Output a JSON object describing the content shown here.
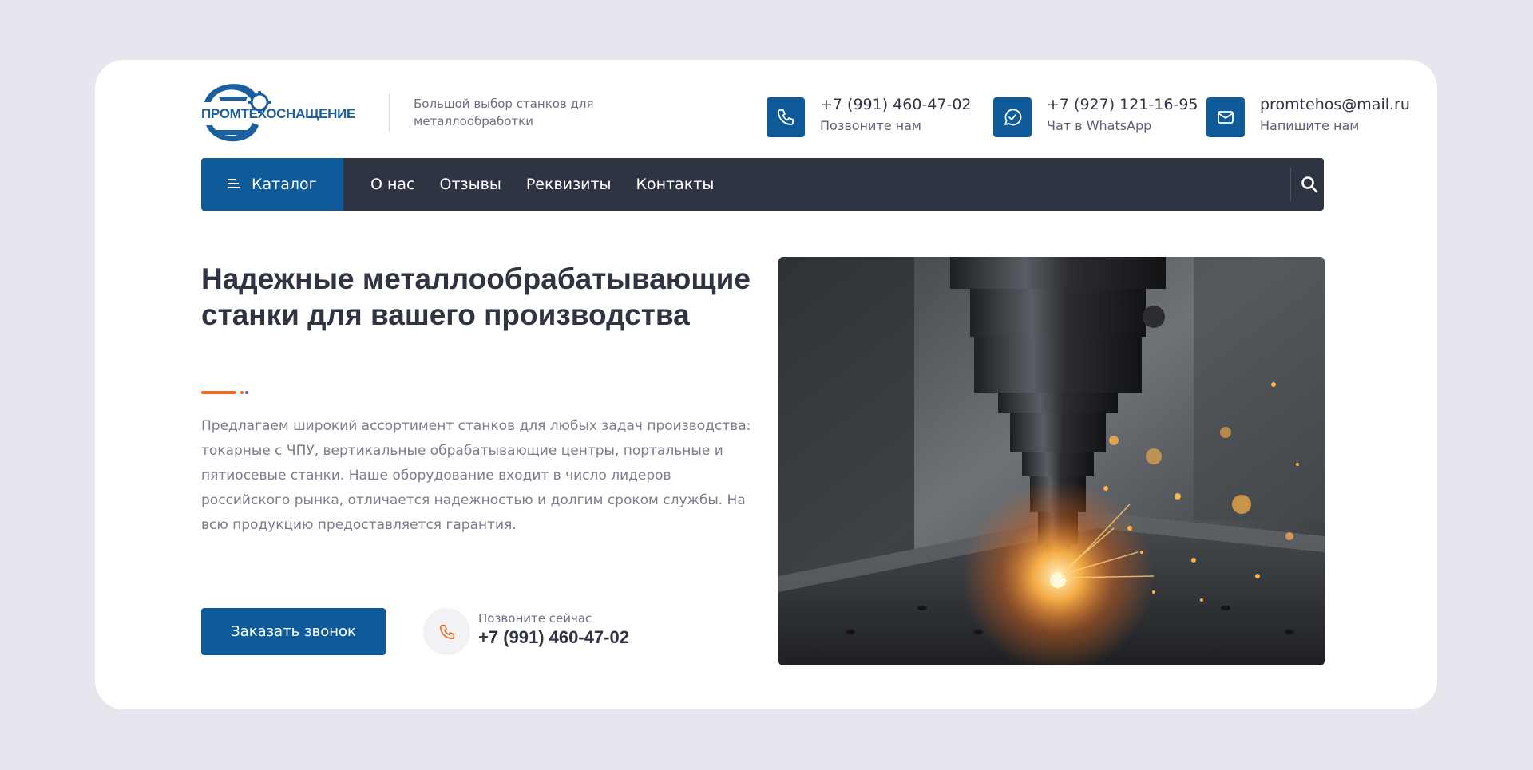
{
  "brand": {
    "logo_text": "ПРОМТЕХОСНАЩЕНИЕ",
    "tagline": "Большой выбор станков для металлообработки"
  },
  "contacts": [
    {
      "icon": "phone-icon",
      "main": "+7 (991) 460-47-02",
      "sub": "Позвоните нам"
    },
    {
      "icon": "whatsapp-icon",
      "main": "+7 (927) 121-16-95",
      "sub": "Чат в WhatsApp"
    },
    {
      "icon": "mail-icon",
      "main": "promtehos@mail.ru",
      "sub": "Напишите нам"
    }
  ],
  "nav": {
    "catalog": "Каталог",
    "links": [
      "О нас",
      "Отзывы",
      "Реквизиты",
      "Контакты"
    ]
  },
  "hero": {
    "title": "Надежные металлообрабатывающие станки для вашего производства",
    "description": "Предлагаем широкий ассортимент станков для любых задач производства: токарные с ЧПУ, вертикальные обрабатывающие центры, портальные и пятиосевые станки. Наше оборудование входит в число лидеров российского рынка, отличается надежностью и долгим сроком службы. На всю продукцию предоставляется гарантия.",
    "cta_button": "Заказать звонок",
    "call_label": "Позвоните сейчас",
    "call_phone": "+7 (991) 460-47-02"
  },
  "colors": {
    "brand_blue": "#0f5a98",
    "nav_dark": "#2f3442",
    "accent_orange": "#f06b1f",
    "accent_purple": "#6d5bd0"
  }
}
